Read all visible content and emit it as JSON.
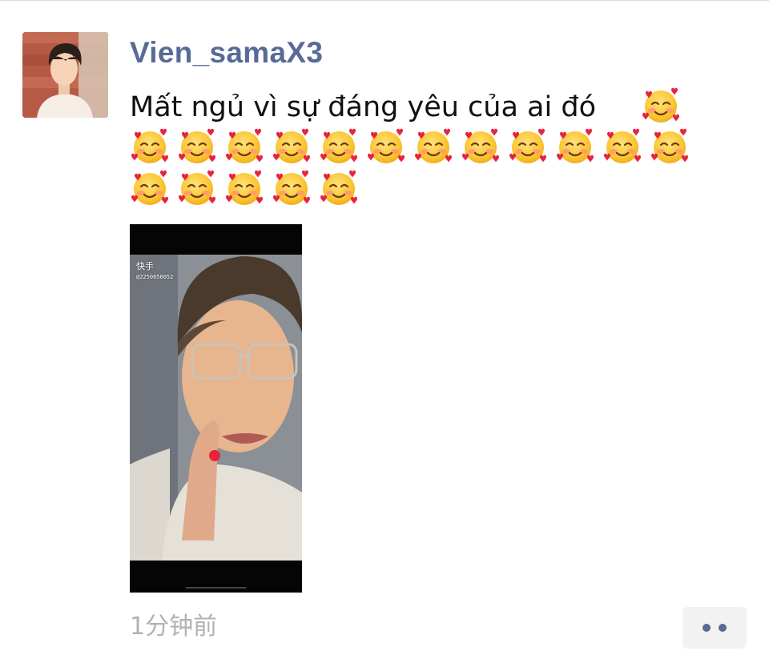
{
  "post": {
    "username": "Vien_samaX3",
    "text": "Mất ngủ vì sự đáng yêu của ai đó",
    "emoji_name": "smiling-face-with-hearts",
    "emoji_rows": [
      12,
      5
    ],
    "timestamp": "1分钟前"
  },
  "video": {
    "app_logo": "快手",
    "user_id": "@2250650052"
  },
  "colors": {
    "username": "#576b95",
    "timestamp": "#b2b2b2",
    "more_button_bg": "#f2f2f2"
  },
  "icons": {
    "more": "more-dots-icon",
    "logo": "kuaishou-logo-icon"
  }
}
